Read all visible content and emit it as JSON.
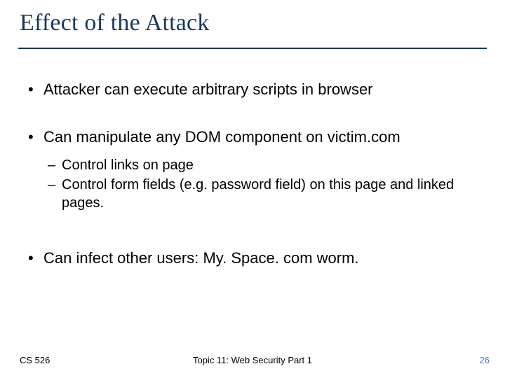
{
  "title": "Effect of the Attack",
  "bullets": {
    "b1": "Attacker can execute arbitrary scripts in browser",
    "b2": "Can manipulate any DOM component on victim.com",
    "b2_sub1": "Control links on page",
    "b2_sub2": "Control form fields (e.g. password field) on this page and linked pages.",
    "b3": "Can infect other users:    My. Space. com   worm."
  },
  "footer": {
    "left": "CS 526",
    "center": "Topic 11: Web Security Part 1",
    "right": "26"
  }
}
